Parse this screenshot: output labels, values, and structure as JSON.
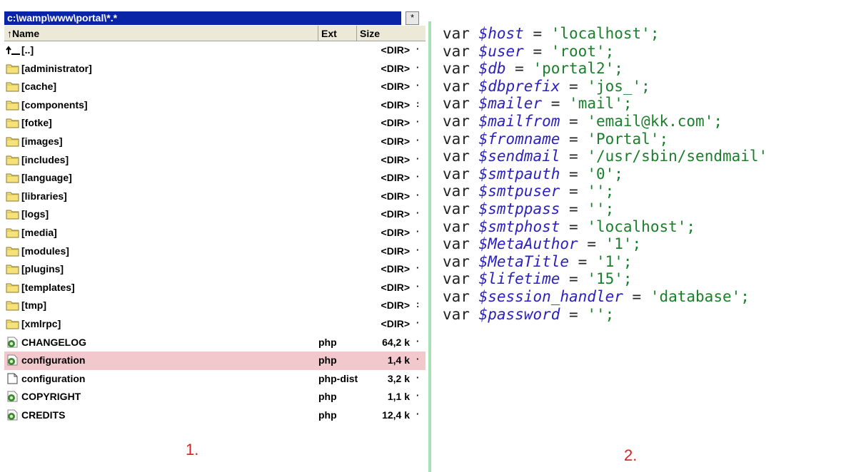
{
  "file_manager": {
    "path": "c:\\wamp\\www\\portal\\*.*",
    "path_button_label": "*",
    "columns": {
      "name": "↑Name",
      "ext": "Ext",
      "size": "Size"
    },
    "rows": [
      {
        "icon": "up-dir-icon",
        "name": "[..]",
        "ext": "",
        "size": "<DIR>",
        "trail": "·"
      },
      {
        "icon": "folder-icon",
        "name": "[administrator]",
        "ext": "",
        "size": "<DIR>",
        "trail": "·"
      },
      {
        "icon": "folder-icon",
        "name": "[cache]",
        "ext": "",
        "size": "<DIR>",
        "trail": "·"
      },
      {
        "icon": "folder-icon",
        "name": "[components]",
        "ext": "",
        "size": "<DIR>",
        "trail": ":"
      },
      {
        "icon": "folder-icon",
        "name": "[fotke]",
        "ext": "",
        "size": "<DIR>",
        "trail": "·"
      },
      {
        "icon": "folder-icon",
        "name": "[images]",
        "ext": "",
        "size": "<DIR>",
        "trail": "·"
      },
      {
        "icon": "folder-icon",
        "name": "[includes]",
        "ext": "",
        "size": "<DIR>",
        "trail": "·"
      },
      {
        "icon": "folder-icon",
        "name": "[language]",
        "ext": "",
        "size": "<DIR>",
        "trail": "·"
      },
      {
        "icon": "folder-icon",
        "name": "[libraries]",
        "ext": "",
        "size": "<DIR>",
        "trail": "·"
      },
      {
        "icon": "folder-icon",
        "name": "[logs]",
        "ext": "",
        "size": "<DIR>",
        "trail": "·"
      },
      {
        "icon": "folder-icon",
        "name": "[media]",
        "ext": "",
        "size": "<DIR>",
        "trail": "·"
      },
      {
        "icon": "folder-icon",
        "name": "[modules]",
        "ext": "",
        "size": "<DIR>",
        "trail": "·"
      },
      {
        "icon": "folder-icon",
        "name": "[plugins]",
        "ext": "",
        "size": "<DIR>",
        "trail": "·"
      },
      {
        "icon": "folder-icon",
        "name": "[templates]",
        "ext": "",
        "size": "<DIR>",
        "trail": "·"
      },
      {
        "icon": "folder-icon",
        "name": "[tmp]",
        "ext": "",
        "size": "<DIR>",
        "trail": ":"
      },
      {
        "icon": "folder-icon",
        "name": "[xmlrpc]",
        "ext": "",
        "size": "<DIR>",
        "trail": "·"
      },
      {
        "icon": "php-file-icon",
        "name": "CHANGELOG",
        "ext": "php",
        "size": "64,2 k",
        "trail": "·"
      },
      {
        "icon": "php-file-icon",
        "name": "configuration",
        "ext": "php",
        "size": "1,4 k",
        "trail": "·",
        "selected": true
      },
      {
        "icon": "blank-file-icon",
        "name": "configuration",
        "ext": "php-dist",
        "size": "3,2 k",
        "trail": "·"
      },
      {
        "icon": "php-file-icon",
        "name": "COPYRIGHT",
        "ext": "php",
        "size": "1,1 k",
        "trail": "·"
      },
      {
        "icon": "php-file-icon",
        "name": "CREDITS",
        "ext": "php",
        "size": "12,4 k",
        "trail": "·"
      }
    ],
    "colors": {
      "path_bg": "#0a24a8",
      "selected_row": "#f3c8cd",
      "folder": "#f5e27a"
    }
  },
  "labels": {
    "left": "1.",
    "right": "2."
  },
  "code_lines": [
    {
      "kw": "var",
      "var": "$host",
      "val": "'localhost';"
    },
    {
      "kw": "var",
      "var": "$user",
      "val": "'root';"
    },
    {
      "kw": "var",
      "var": "$db",
      "val": "'portal2';"
    },
    {
      "kw": "var",
      "var": "$dbprefix",
      "val": "'jos_';"
    },
    {
      "kw": "var",
      "var": "$mailer",
      "val": "'mail';"
    },
    {
      "kw": "var",
      "var": "$mailfrom",
      "val": "'email@kk.com';"
    },
    {
      "kw": "var",
      "var": "$fromname",
      "val": "'Portal';"
    },
    {
      "kw": "var",
      "var": "$sendmail",
      "val": "'/usr/sbin/sendmail'"
    },
    {
      "kw": "var",
      "var": "$smtpauth",
      "val": "'0';"
    },
    {
      "kw": "var",
      "var": "$smtpuser",
      "val": "'';"
    },
    {
      "kw": "var",
      "var": "$smtppass",
      "val": "'';"
    },
    {
      "kw": "var",
      "var": "$smtphost",
      "val": "'localhost';"
    },
    {
      "kw": "var",
      "var": "$MetaAuthor",
      "val": "'1';"
    },
    {
      "kw": "var",
      "var": "$MetaTitle",
      "val": "'1';"
    },
    {
      "kw": "var",
      "var": "$lifetime",
      "val": "'15';"
    },
    {
      "kw": "var",
      "var": "$session_handler",
      "val": "'database';"
    },
    {
      "kw": "var",
      "var": "$password",
      "val": "'';"
    }
  ]
}
